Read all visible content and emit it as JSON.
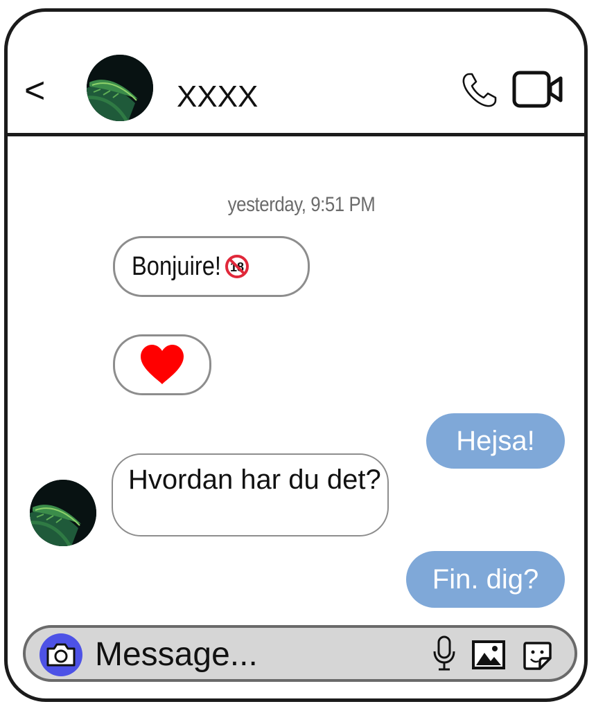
{
  "header": {
    "back_label": "<",
    "contact_name": "XXXX",
    "icons": [
      "back-chevron",
      "avatar",
      "phone-icon",
      "video-icon"
    ]
  },
  "conversation": {
    "timestamp": "yesterday, 9:51 PM",
    "messages": [
      {
        "direction": "incoming",
        "text": "Bonjuire!",
        "emoji": "no-one-under-18-icon"
      },
      {
        "direction": "incoming",
        "text": "",
        "emoji": "heart-icon"
      },
      {
        "direction": "outgoing",
        "text": "Hejsa!"
      },
      {
        "direction": "incoming",
        "text": "Hvordan har du det?",
        "avatar": true
      },
      {
        "direction": "outgoing",
        "text": "Fin. dig?"
      }
    ]
  },
  "composer": {
    "placeholder": "Message...",
    "icons": [
      "camera-icon",
      "microphone-icon",
      "image-icon",
      "sticker-icon"
    ]
  },
  "colors": {
    "outgoing_bubble": "#7fa8d8",
    "camera_button": "#4d52e6",
    "composer_bg": "#d6d6d6",
    "heart": "#ff0000"
  }
}
